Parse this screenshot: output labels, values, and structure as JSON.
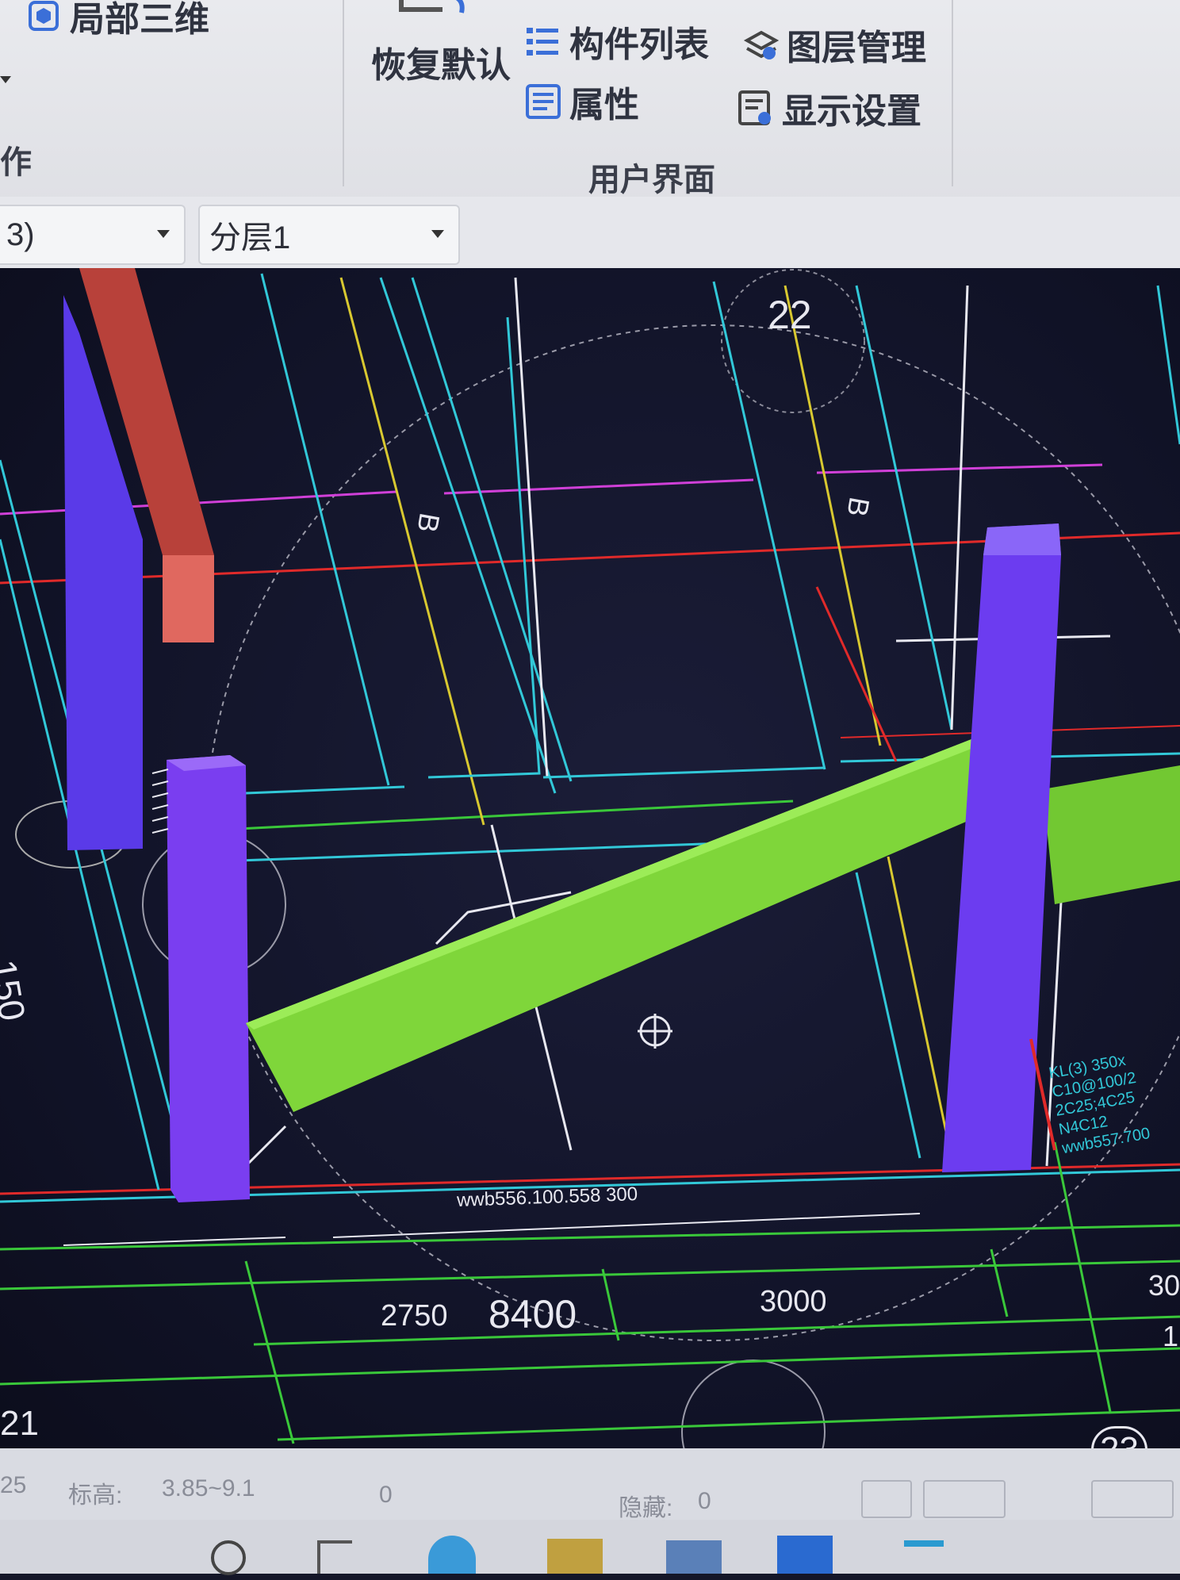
{
  "ribbon": {
    "local_3d": "局部三维",
    "left_group_label_partial": "作",
    "restore_default": "恢复默认",
    "component_list": "构件列表",
    "layer_manage": "图层管理",
    "properties": "属性",
    "display_settings": "显示设置",
    "user_interface_group": "用户界面"
  },
  "toolbar": {
    "floor_combo_value": "3)",
    "layer_combo_value": "分层1"
  },
  "viewport": {
    "axis_22": "22",
    "axis_21": "21",
    "axis_23": "23",
    "dim_150": "150",
    "dim_2750": "2750",
    "dim_8400": "8400",
    "dim_3000": "3000",
    "dim_30": "30",
    "dim_1": "1",
    "beam_tag": "wwb556.100.558 300",
    "beam_note": "KL(3) 350x\nC10@100/2\n2C25;4C25\nN4C12\nwwb557.700",
    "mark_b1": "B",
    "mark_b2": "B",
    "colors": {
      "column": "#6a3ff0",
      "beam_green": "#7fd63a",
      "beam_red": "#c8483c",
      "cyan_line": "#32c8d8",
      "magenta_line": "#d040d8",
      "red_line": "#e02a2a",
      "yellow_line": "#d8c830",
      "green_line": "#3ac83a"
    }
  },
  "status": {
    "left_num": "25",
    "elevation_label": "标高:",
    "elevation_value": "3.85~9.1",
    "zero": "0",
    "hidden_label": "隐藏:",
    "hidden_value": "0"
  }
}
